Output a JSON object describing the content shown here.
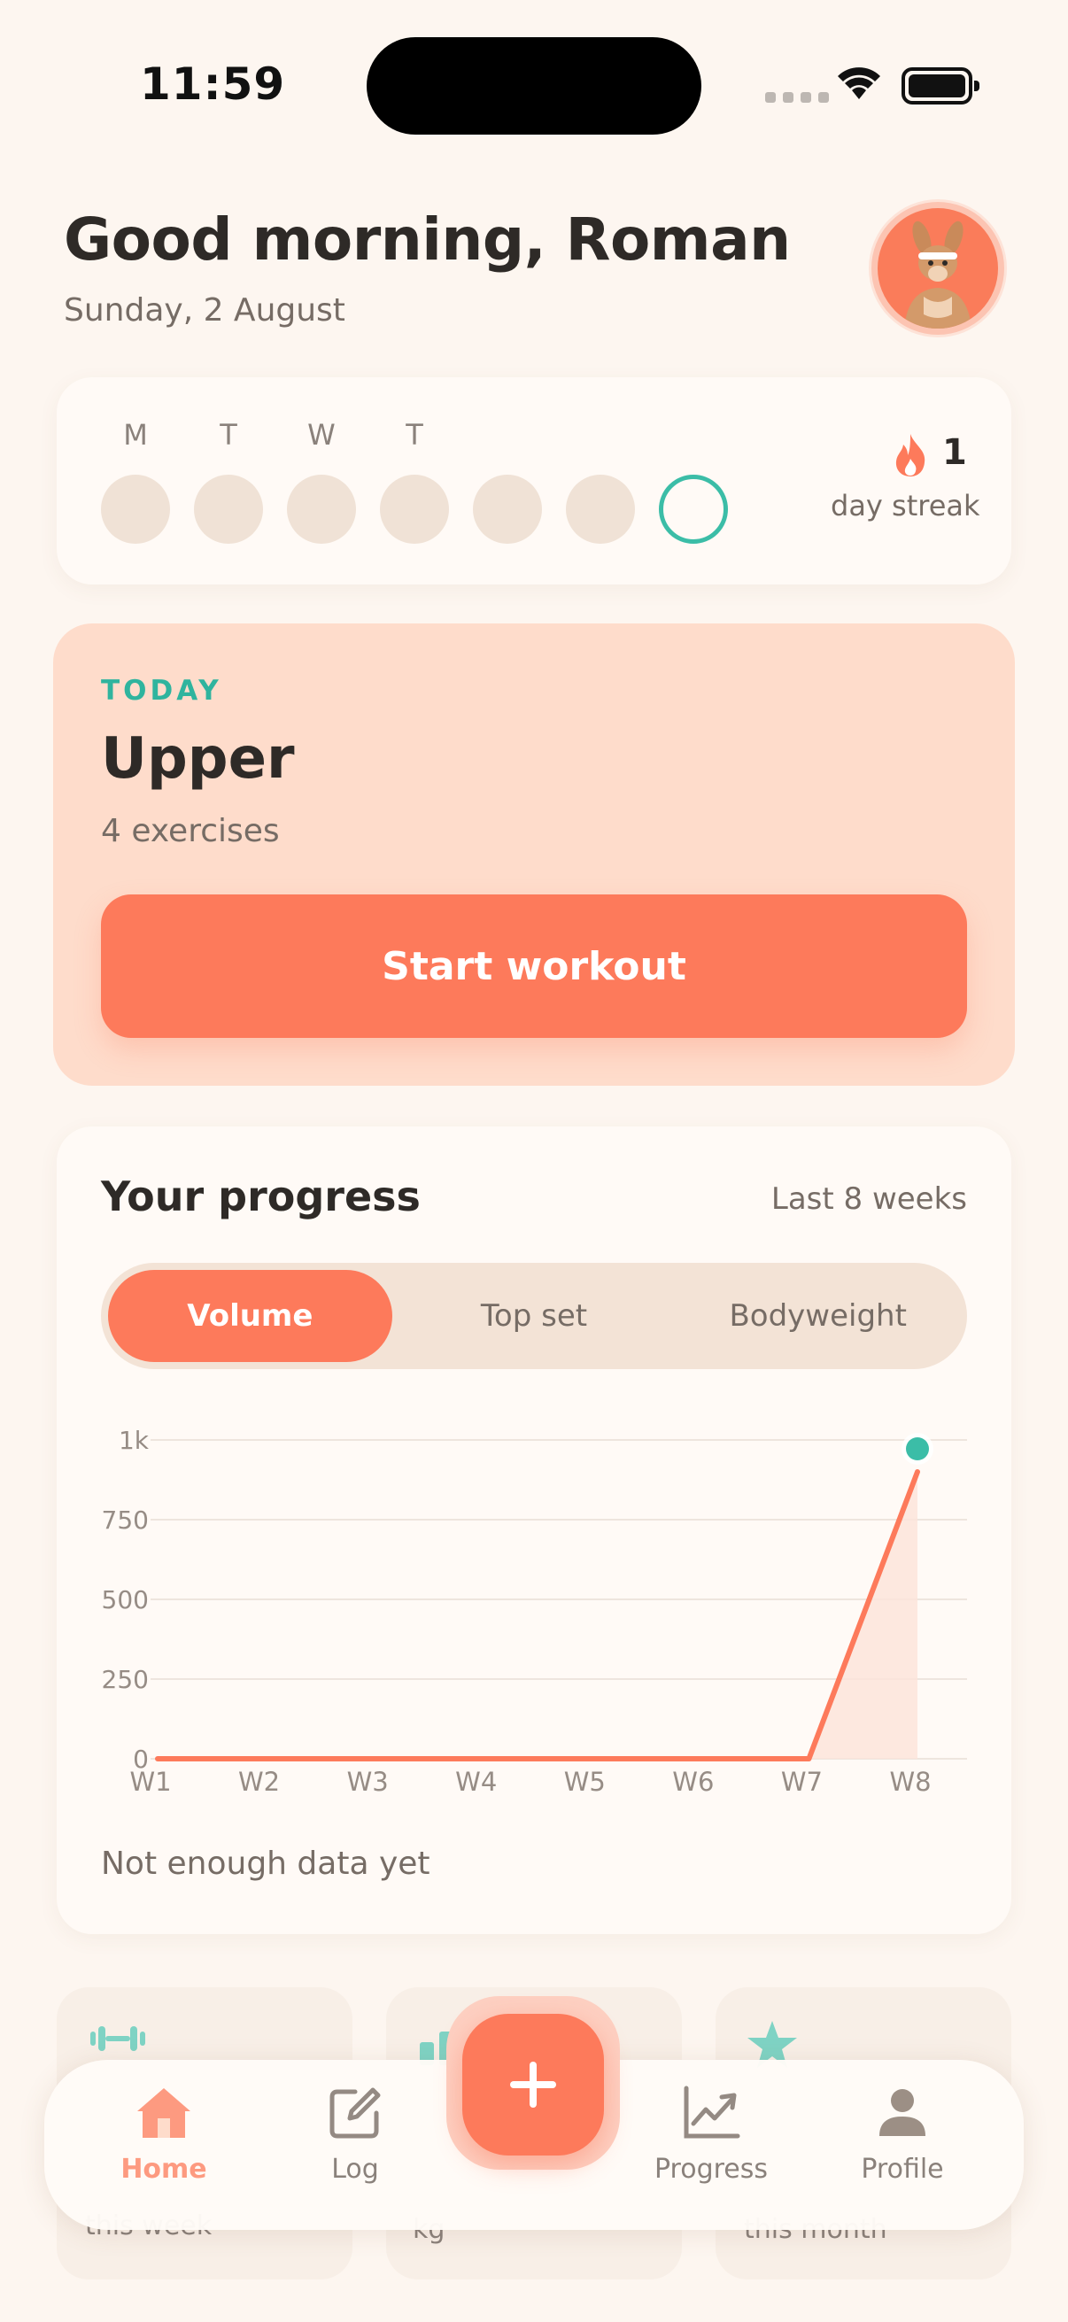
{
  "status_bar": {
    "time": "11:59"
  },
  "header": {
    "greeting": "Good morning, Roman",
    "date": "Sunday, 2 August",
    "avatar_icon": "kangaroo-avatar-icon"
  },
  "streak": {
    "day_labels": [
      "M",
      "T",
      "W",
      "T",
      "",
      "",
      ""
    ],
    "days_done": [
      false,
      false,
      false,
      false,
      false,
      false,
      false
    ],
    "today_index": 6,
    "count": "1",
    "label": "day streak",
    "icon": "flame-icon"
  },
  "today": {
    "kicker": "TODAY",
    "title": "Upper",
    "subtitle": "4 exercises",
    "start_label": "Start workout"
  },
  "progress": {
    "title": "Your progress",
    "range": "Last 8 weeks",
    "tabs": [
      {
        "label": "Volume",
        "active": true
      },
      {
        "label": "Top set",
        "active": false
      },
      {
        "label": "Bodyweight",
        "active": false
      }
    ],
    "note": "Not enough data yet"
  },
  "chart_data": {
    "type": "area",
    "categories": [
      "W1",
      "W2",
      "W3",
      "W4",
      "W5",
      "W6",
      "W7",
      "W8"
    ],
    "values": [
      0,
      0,
      0,
      0,
      0,
      0,
      0,
      900
    ],
    "y_ticks": [
      0,
      250,
      500,
      750,
      1000
    ],
    "y_tick_labels": [
      "0",
      "250",
      "500",
      "750",
      "1k"
    ],
    "ylim": [
      0,
      1000
    ],
    "grid": true,
    "line_color": "#fd7a5b",
    "fill_color": "#fde3da",
    "highlight_color": "#3bbda7"
  },
  "stats": [
    {
      "icon": "dumbbell-icon",
      "label": "this week"
    },
    {
      "icon": "bar-chart-icon",
      "label": "kg"
    },
    {
      "icon": "star-icon",
      "label": "this month"
    }
  ],
  "tabbar": {
    "items": [
      {
        "label": "Home",
        "icon": "home-icon",
        "active": true
      },
      {
        "label": "Log",
        "icon": "edit-icon",
        "active": false
      },
      {
        "label": "Progress",
        "icon": "trend-chart-icon",
        "active": false
      },
      {
        "label": "Profile",
        "icon": "user-icon",
        "active": false
      }
    ],
    "fab_icon": "plus-icon"
  },
  "colors": {
    "accent": "#fd7a5b",
    "teal": "#3bbda7",
    "background": "#fdf6f0"
  }
}
